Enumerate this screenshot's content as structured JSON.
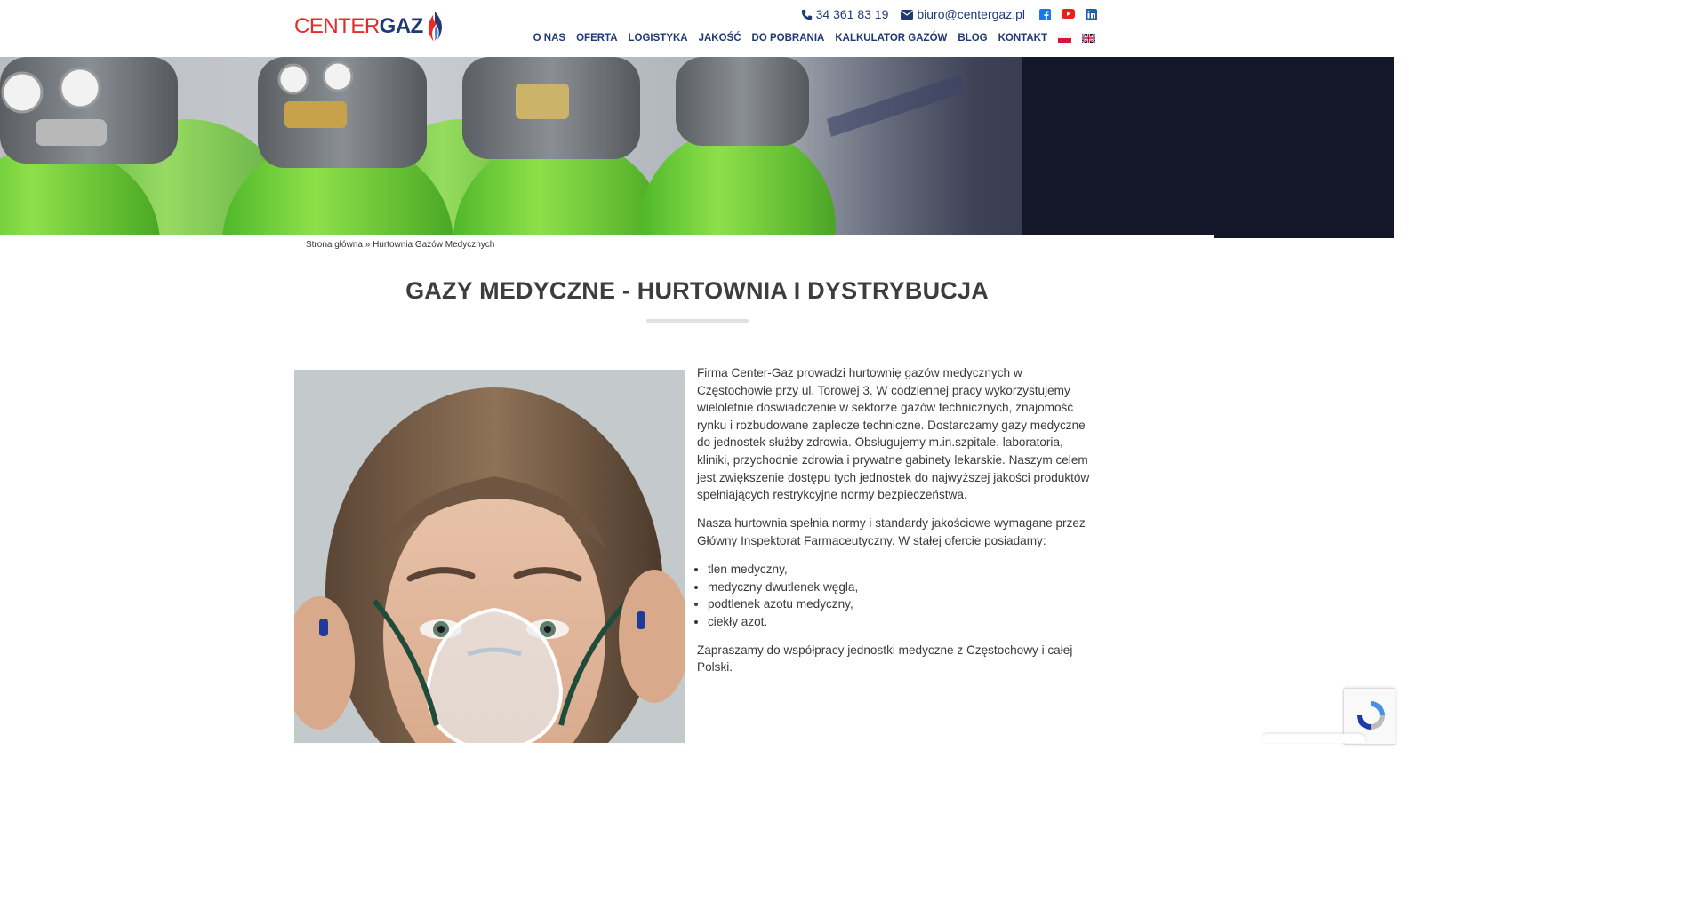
{
  "header": {
    "logo": {
      "part1": "CENTER",
      "part2": "GAZ"
    },
    "phone": "34 361 83 19",
    "email": "biuro@centergaz.pl",
    "social": [
      "facebook-icon",
      "youtube-icon",
      "linkedin-icon"
    ],
    "nav": [
      "O NAS",
      "OFERTA",
      "LOGISTYKA",
      "JAKOŚĆ",
      "DO POBRANIA",
      "KALKULATOR GAZÓW",
      "BLOG",
      "KONTAKT"
    ],
    "languages": [
      "pl-flag-icon",
      "en-flag-icon"
    ]
  },
  "breadcrumb": {
    "home": "Strona główna",
    "separator": " » ",
    "current": "Hurtownia Gazów Medycznych"
  },
  "page": {
    "title": "GAZY MEDYCZNE - HURTOWNIA I DYSTRYBUCJA",
    "paragraph1": "Firma Center-Gaz prowadzi hurtownię gazów medycznych w Częstochowie przy ul. Torowej 3. W codziennej pracy wykorzystujemy wieloletnie doświadczenie w sektorze gazów technicznych, znajomość rynku i rozbudowane zaplecze techniczne. Dostarczamy gazy medyczne do jednostek służby zdrowia. Obsługujemy m.in.szpitale, laboratoria, kliniki, przychodnie zdrowia i prywatne gabinety lekarskie. Naszym celem jest zwiększenie dostępu tych jednostek do najwyższej jakości produktów spełniających restrykcyjne normy bezpieczeństwa.",
    "paragraph2": "Nasza hurtownia spełnia normy i standardy jakościowe wymagane przez Główny Inspektorat Farmaceutyczny. W stałej ofercie posiadamy:",
    "list": [
      "tlen medyczny,",
      "medyczny dwutlenek węgla,",
      "podtlenek azotu medyczny,",
      "ciekły azot."
    ],
    "paragraph3": "Zapraszamy do współpracy jednostki medyczne z Częstochowy i całej Polski."
  },
  "colors": {
    "brand_blue": "#1f3a75",
    "brand_red": "#e52b2b",
    "cylinder_green": "#7ed23a"
  }
}
